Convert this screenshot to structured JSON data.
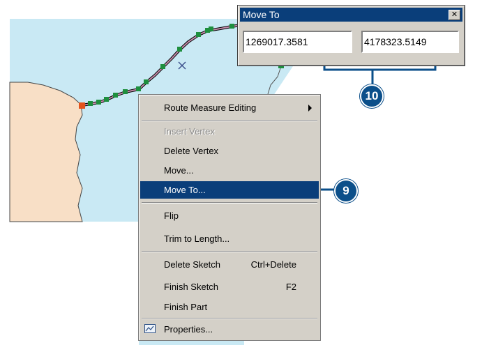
{
  "context_menu": {
    "items": [
      {
        "label": "Route Measure Editing",
        "enabled": true,
        "submenu": true
      },
      {
        "label": "Insert Vertex",
        "enabled": false
      },
      {
        "label": "Delete Vertex",
        "enabled": true
      },
      {
        "label": "Move...",
        "enabled": true
      },
      {
        "label": "Move To...",
        "enabled": true,
        "highlighted": true
      },
      {
        "label": "Flip",
        "enabled": true
      },
      {
        "label": "Trim to Length...",
        "enabled": true
      },
      {
        "label": "Delete Sketch",
        "shortcut": "Ctrl+Delete",
        "enabled": true
      },
      {
        "label": "Finish Sketch",
        "shortcut": "F2",
        "enabled": true
      },
      {
        "label": "Finish Part",
        "enabled": true
      },
      {
        "label": "Properties...",
        "enabled": true,
        "icon": "properties-icon"
      }
    ]
  },
  "move_to_dialog": {
    "title": "Move To",
    "close_label": "✕",
    "x_value": "1269017.3581",
    "y_value": "4178323.5149"
  },
  "callouts": {
    "step_9": "9",
    "step_10": "10"
  },
  "colors": {
    "water": "#c8e9f4",
    "land": "#f8dfc6",
    "highlight": "#0a3e7a",
    "callout": "#0b4f8a",
    "vertex": "#1a8a3a",
    "vertex_selected": "#e0501a",
    "sketch_line": "#8a3a6a"
  }
}
